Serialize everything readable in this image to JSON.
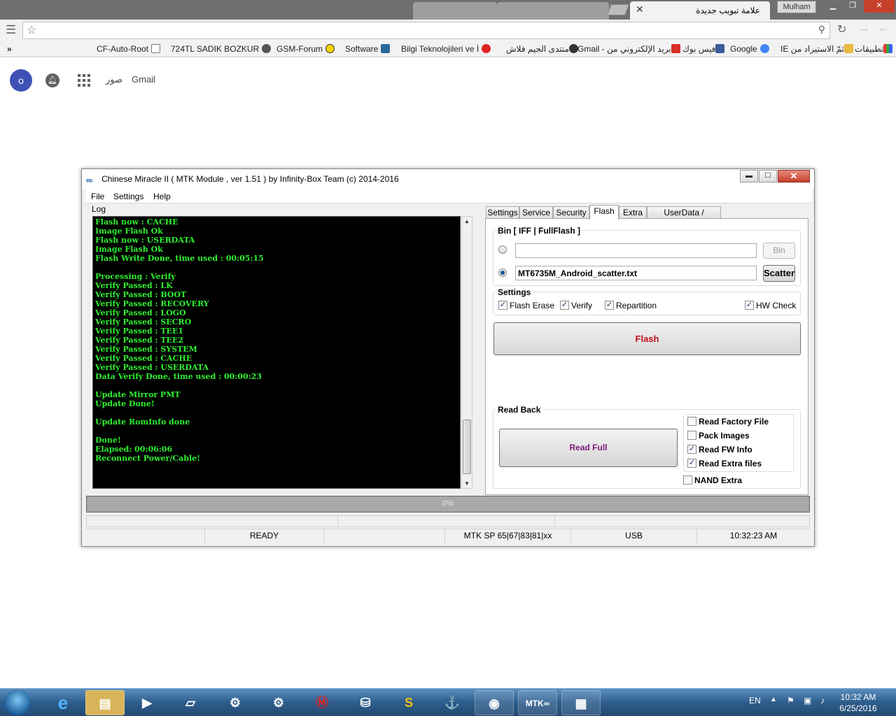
{
  "browser": {
    "active_tab_title": "علامة تبويب جديدة",
    "profile_name": "Mulham",
    "bookmarks": [
      {
        "label": "تطبيقات",
        "icon": "apps-icon"
      },
      {
        "label": "ثمّ الاستيراد من IE",
        "icon": "folder-icon"
      },
      {
        "label": "Google",
        "icon": "google-icon"
      },
      {
        "label": "فيس بوك",
        "icon": "facebook-icon"
      },
      {
        "label": "بريد الإلكتروني من - Gmail",
        "icon": "gmail-icon"
      },
      {
        "label": "منتدى الجيم فلاش",
        "icon": "site-icon"
      },
      {
        "label": "Bilgi Teknolojileri ve İ",
        "icon": "site-icon"
      },
      {
        "label": "Software",
        "icon": "site-icon"
      },
      {
        "label": "GSM-Forum",
        "icon": "smiley-icon"
      },
      {
        "label": "724TL SADIK BOZKUR",
        "icon": "site-icon"
      },
      {
        "label": "CF-Auto-Root",
        "icon": "page-icon"
      }
    ],
    "overflow_label": "»"
  },
  "gmail_bar": {
    "avatar_letter": "o",
    "gmail_label": "Gmail",
    "images_label": "صور"
  },
  "app": {
    "title": "Chinese Miracle II ( MTK Module , ver 1.51 ) by Infinity-Box Team (c) 2014-2016",
    "logo_text": "∞",
    "menu": [
      "File",
      "Settings",
      "Help"
    ],
    "log_label": "Log",
    "log_lines": [
      "Flash now : CACHE",
      "Image Flash Ok",
      "Flash now : USERDATA",
      "Image Flash Ok",
      "Flash Write Done, time used : 00:05:15",
      "",
      "Processing : Verify",
      "Verify Passed : LK",
      "Verify Passed : BOOT",
      "Verify Passed : RECOVERY",
      "Verify Passed : LOGO",
      "Verify Passed : SECRO",
      "Verify Passed : TEE1",
      "Verify Passed : TEE2",
      "Verify Passed : SYSTEM",
      "Verify Passed : CACHE",
      "Verify Passed : USERDATA",
      "Data Verify Done, time used : 00:00:23",
      "",
      "Update Mirror PMT",
      "Update Done!",
      "",
      "Update RomInfo done",
      "",
      "Done!",
      "Elapsed: 00:06:06",
      "Reconnect Power/Cable!"
    ],
    "tabs": [
      "Settings",
      "Service",
      "Security",
      "Flash",
      "Extra",
      "UserData / Forensic"
    ],
    "active_tab": "Flash",
    "flash": {
      "bin_group_title": "Bin  [ IFF | FullFlash ]",
      "bin_path": "",
      "bin_button": "Bin",
      "scatter_path": "MT6735M_Android_scatter.txt",
      "scatter_button": "Scatter",
      "selected_source": "scatter",
      "settings_title": "Settings",
      "options": [
        {
          "label": "Flash Erase",
          "checked": true
        },
        {
          "label": "Verify",
          "checked": true
        },
        {
          "label": "Repartition",
          "checked": true
        },
        {
          "label": "HW Check",
          "checked": true
        }
      ],
      "flash_button": "Flash",
      "readback_title": "Read Back",
      "read_full_button": "Read Full",
      "readback_options": [
        {
          "label": "Read Factory File",
          "checked": false
        },
        {
          "label": "Pack Images",
          "checked": false
        },
        {
          "label": "Read FW Info",
          "checked": true
        },
        {
          "label": "Read Extra files",
          "checked": true
        }
      ],
      "nand_extra": {
        "label": "NAND Extra",
        "checked": false
      }
    },
    "progress_text": "0%",
    "progress_value": 0,
    "status": {
      "state": "READY",
      "platform": "MTK SP 65|67|83|81|xx",
      "connection": "USB",
      "time": "10:32:23 AM"
    }
  },
  "taskbar": {
    "language": "EN",
    "clock_time": "10:32 AM",
    "clock_date": "6/25/2016"
  },
  "colors": {
    "console_bg": "#000000",
    "console_text": "#2ef02e",
    "flash_label": "#c0101a",
    "read_full_label": "#7a1a7a",
    "taskbar": "#2e5d8c"
  }
}
